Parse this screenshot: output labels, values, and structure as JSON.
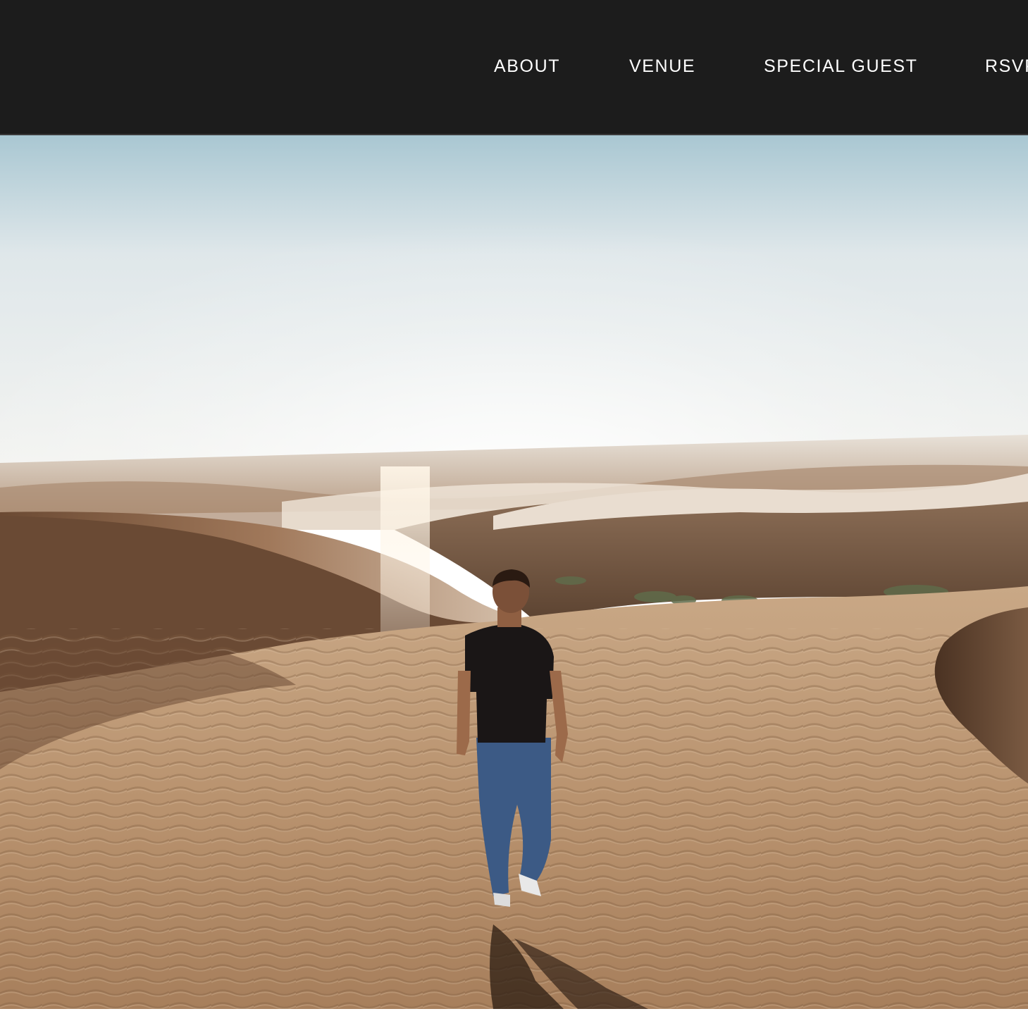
{
  "nav": {
    "items": [
      {
        "label": "ABOUT"
      },
      {
        "label": "VENUE"
      },
      {
        "label": "SPECIAL GUEST"
      },
      {
        "label": "RSVP"
      }
    ]
  },
  "colors": {
    "header_bg": "#1c1c1c",
    "nav_text": "#ffffff",
    "sky_top": "#9fc3cf",
    "sky_horizon": "#f2f3f1",
    "sand_light": "#d6b592",
    "sand_dark": "#5a3e2a"
  },
  "hero": {
    "image": "desert-dunes-man-walking-photo"
  }
}
